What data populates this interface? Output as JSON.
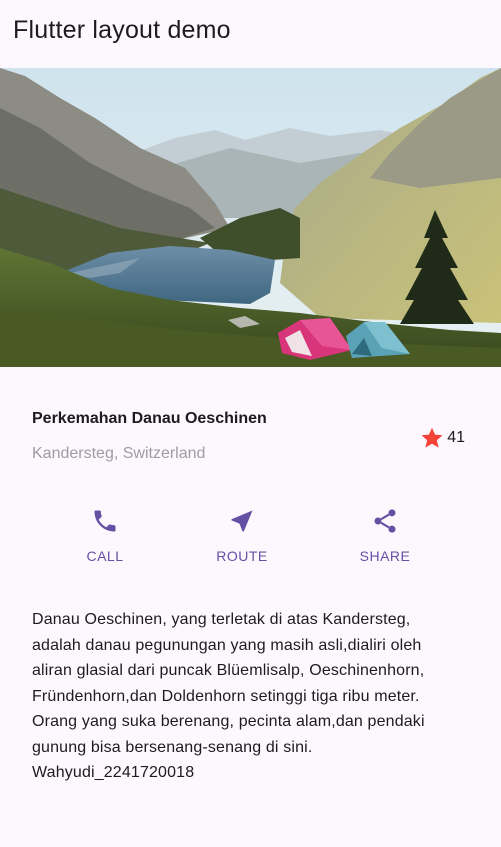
{
  "appbar": {
    "title": "Flutter layout demo"
  },
  "hero_image": {
    "alt": "lake-mountains-tents-photo"
  },
  "title_section": {
    "name": "Perkemahan Danau Oeschinen",
    "location": "Kandersteg, Switzerland",
    "rating_count": "41",
    "star_color": "#f44336"
  },
  "buttons": [
    {
      "label": "CALL",
      "icon": "phone-icon"
    },
    {
      "label": "ROUTE",
      "icon": "navigation-icon"
    },
    {
      "label": "SHARE",
      "icon": "share-icon"
    }
  ],
  "accent_color": "#6650a4",
  "description": "Danau Oeschinen, yang terletak di atas Kandersteg,\nadalah danau pegunungan yang masih asli,dialiri oleh\naliran glasial dari puncak Blüemlisalp, Oeschinenhorn,\nFründenhorn,dan Doldenhorn setinggi tiga ribu meter.\nOrang yang suka berenang, pecinta alam,dan pendaki\ngunung bisa bersenang-senang di sini.\nWahyudi_2241720018"
}
